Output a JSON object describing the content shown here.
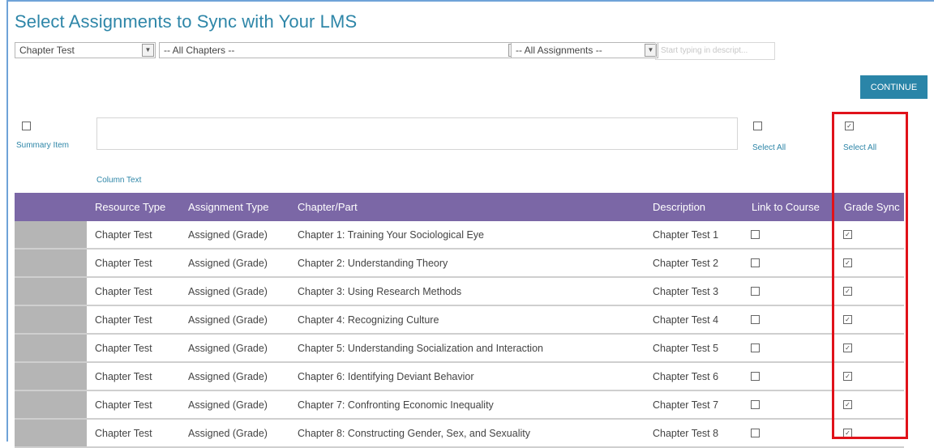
{
  "title": "Select Assignments to Sync with Your LMS",
  "filters": {
    "resource_type": "Chapter Test",
    "chapters": "-- All Chapters --",
    "assignments": "-- All Assignments --",
    "search_placeholder": "Start typing in descript..."
  },
  "continue_label": "CONTINUE",
  "controls": {
    "summary_item_label": "Summary Item",
    "column_text_label": "Column Text",
    "select_all_link_label": "Select All",
    "select_all_grade_label": "Select All",
    "summary_item_checked": false,
    "select_all_link_checked": false,
    "select_all_grade_checked": true
  },
  "table": {
    "headers": {
      "resource_type": "Resource Type",
      "assignment_type": "Assignment Type",
      "chapter_part": "Chapter/Part",
      "description": "Description",
      "link_to_course": "Link to Course",
      "grade_sync": "Grade Sync"
    },
    "rows": [
      {
        "resource_type": "Chapter Test",
        "assignment_type": "Assigned (Grade)",
        "chapter_part": "Chapter 1: Training Your Sociological Eye",
        "description": "Chapter Test 1",
        "link": false,
        "grade": true
      },
      {
        "resource_type": "Chapter Test",
        "assignment_type": "Assigned (Grade)",
        "chapter_part": "Chapter 2: Understanding Theory",
        "description": "Chapter Test 2",
        "link": false,
        "grade": true
      },
      {
        "resource_type": "Chapter Test",
        "assignment_type": "Assigned (Grade)",
        "chapter_part": "Chapter 3: Using Research Methods",
        "description": "Chapter Test 3",
        "link": false,
        "grade": true
      },
      {
        "resource_type": "Chapter Test",
        "assignment_type": "Assigned (Grade)",
        "chapter_part": "Chapter 4: Recognizing Culture",
        "description": "Chapter Test 4",
        "link": false,
        "grade": true
      },
      {
        "resource_type": "Chapter Test",
        "assignment_type": "Assigned (Grade)",
        "chapter_part": "Chapter 5: Understanding Socialization and Interaction",
        "description": "Chapter Test 5",
        "link": false,
        "grade": true
      },
      {
        "resource_type": "Chapter Test",
        "assignment_type": "Assigned (Grade)",
        "chapter_part": "Chapter 6: Identifying Deviant Behavior",
        "description": "Chapter Test 6",
        "link": false,
        "grade": true
      },
      {
        "resource_type": "Chapter Test",
        "assignment_type": "Assigned (Grade)",
        "chapter_part": "Chapter 7: Confronting Economic Inequality",
        "description": "Chapter Test 7",
        "link": false,
        "grade": true
      },
      {
        "resource_type": "Chapter Test",
        "assignment_type": "Assigned (Grade)",
        "chapter_part": "Chapter 8: Constructing Gender, Sex, and Sexuality",
        "description": "Chapter Test 8",
        "link": false,
        "grade": true
      }
    ]
  },
  "colors": {
    "title": "#2e86a8",
    "header_bg": "#7b67a6",
    "continue_bg": "#2a85a8",
    "highlight_border": "#e0121a",
    "row_grip": "#b5b5b5"
  }
}
